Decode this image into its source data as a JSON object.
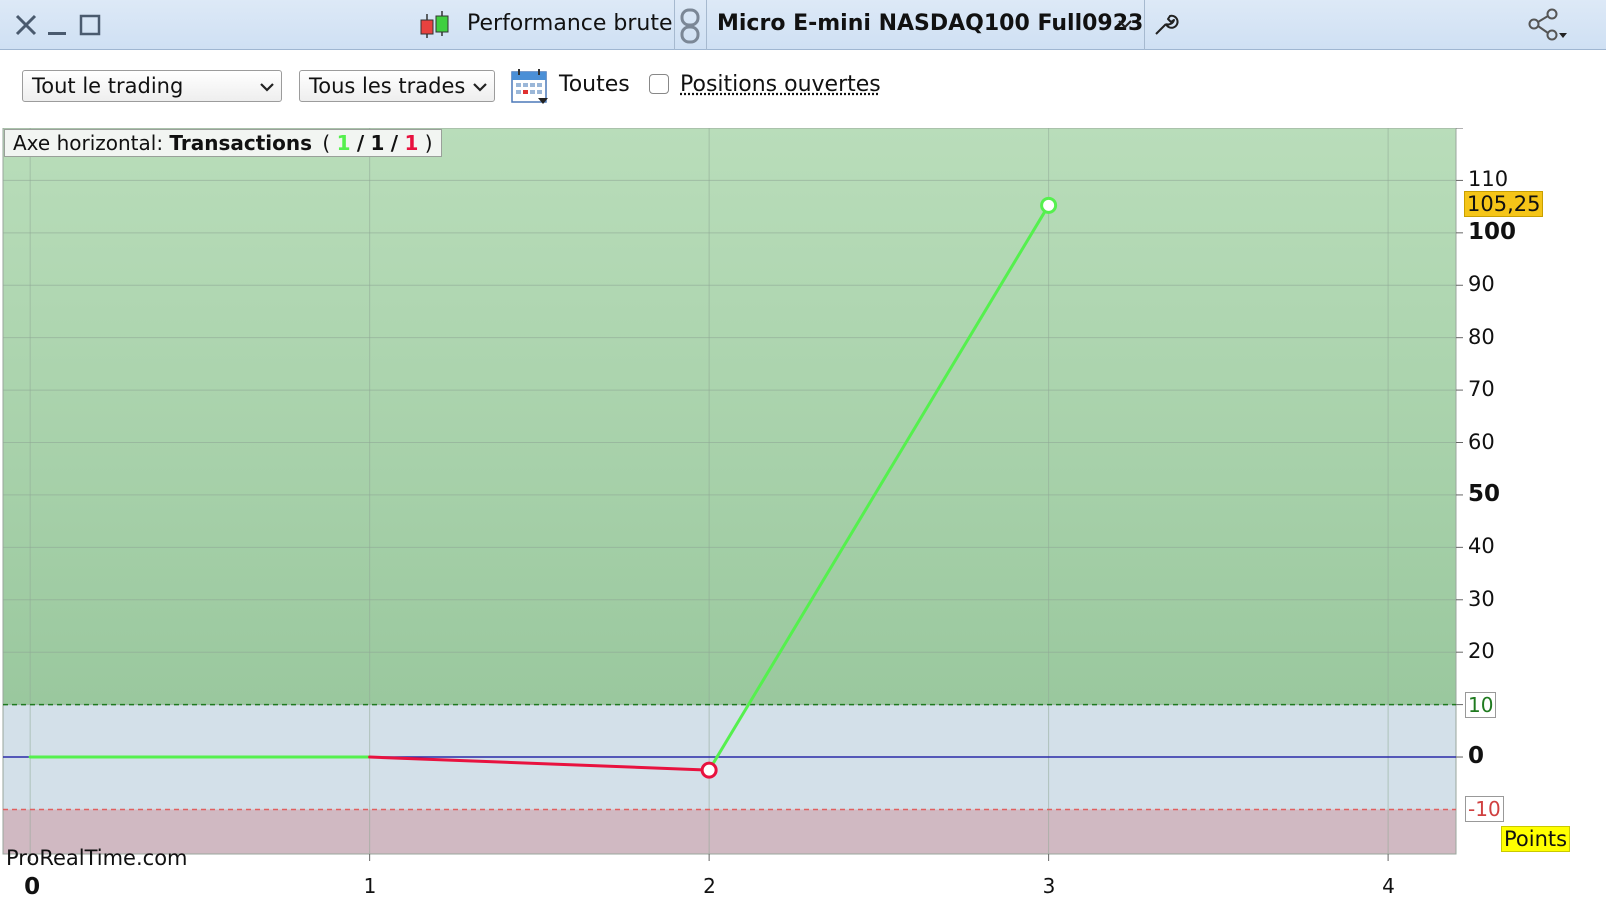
{
  "window": {
    "title": "Performance brute",
    "instrument": "Micro E-mini NASDAQ100 Full0923"
  },
  "toolbar": {
    "period_select": "Tout le trading",
    "trades_select": "Tous les trades",
    "calendar_label": "Toutes",
    "open_positions_label": "Positions ouvertes",
    "open_positions_checked": false
  },
  "axis_badge": {
    "prefix": "Axe horizontal:",
    "mode": "Transactions",
    "open": "(",
    "wins": "1",
    "slash1": "/",
    "total": "1",
    "slash2": "/",
    "losses": "1",
    "close": ")"
  },
  "watermark": "ProRealTime.com",
  "colors": {
    "gain": "#55f04e",
    "loss": "#e8123f",
    "last_value_bg": "#f5c518",
    "units_bg": "#ffff00"
  },
  "chart_data": {
    "type": "line",
    "x_axis": {
      "ticks": [
        0,
        1,
        2,
        3,
        4
      ],
      "range": [
        -0.08,
        4.2
      ]
    },
    "y_axis": {
      "ticks": [
        20,
        30,
        40,
        60,
        70,
        80,
        90,
        110
      ],
      "bold_ticks": [
        0,
        50,
        100
      ],
      "range": [
        -18.5,
        120
      ],
      "units": "Points"
    },
    "series": [
      {
        "x": [
          0,
          1,
          2,
          3
        ],
        "y": [
          0,
          0,
          -2.5,
          105.25
        ]
      }
    ],
    "last_value": "105,25",
    "upper_threshold": {
      "value": 10,
      "label": "10"
    },
    "lower_threshold": {
      "value": -10,
      "label": "-10"
    },
    "zero_line": 0
  }
}
